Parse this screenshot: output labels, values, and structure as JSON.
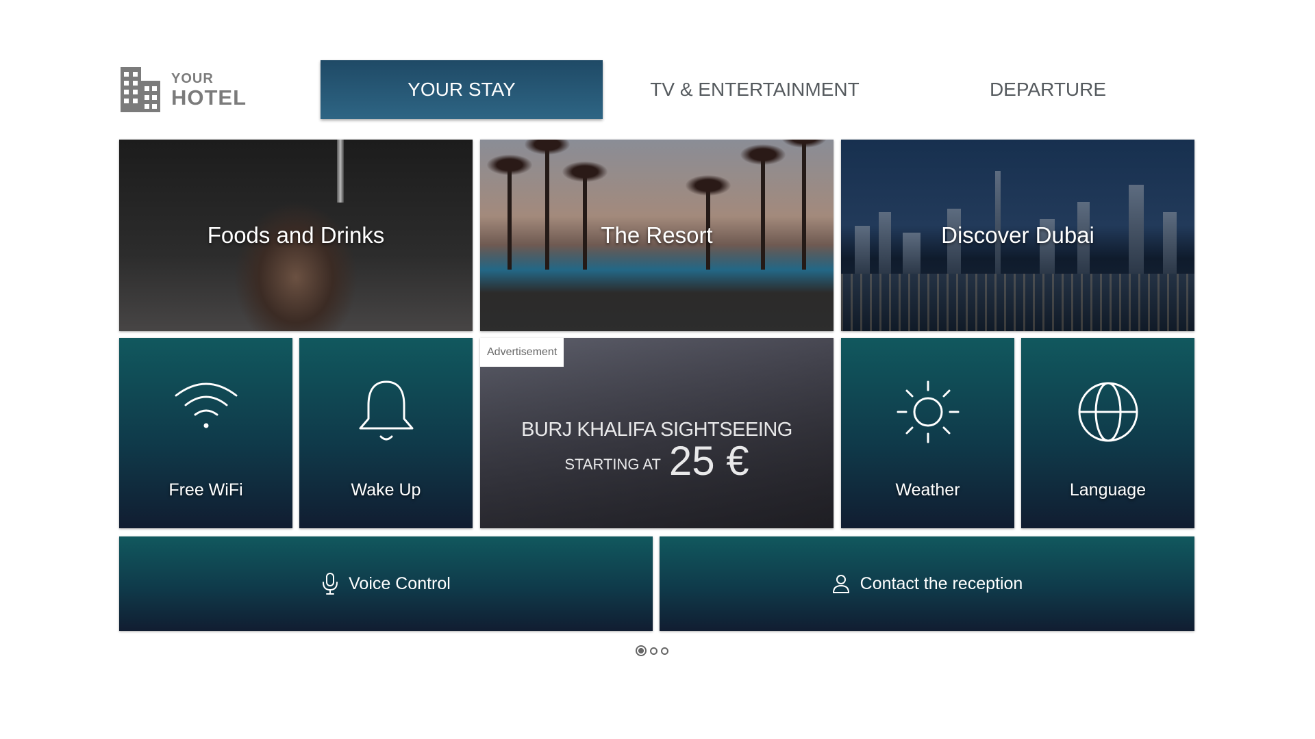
{
  "brand": {
    "small": "YOUR",
    "big": "HOTEL",
    "icon": "building-icon"
  },
  "nav": {
    "tabs": [
      {
        "label": "YOUR STAY",
        "active": true
      },
      {
        "label": "TV & ENTERTAINMENT",
        "active": false
      },
      {
        "label": "DEPARTURE",
        "active": false
      }
    ]
  },
  "tiles": {
    "foods": {
      "label": "Foods and Drinks"
    },
    "resort": {
      "label": "The Resort"
    },
    "dubai": {
      "label": "Discover Dubai"
    },
    "wifi": {
      "label": "Free WiFi",
      "icon": "wifi-icon"
    },
    "wakeup": {
      "label": "Wake Up",
      "icon": "bell-icon"
    },
    "weather": {
      "label": "Weather",
      "icon": "sun-icon"
    },
    "language": {
      "label": "Language",
      "icon": "globe-icon"
    },
    "voice": {
      "label": "Voice Control",
      "icon": "microphone-icon"
    },
    "contact": {
      "label": "Contact the reception",
      "icon": "user-icon"
    }
  },
  "ad": {
    "badge": "Advertisement",
    "title": "BURJ KHALIFA SIGHTSEEING",
    "price_prefix": "STARTING AT",
    "price": "25 €"
  },
  "pagination": {
    "pages": 3,
    "current": 1
  },
  "colors": {
    "active_tab": "#2e6584",
    "tile_teal": "#11585e",
    "tile_dark": "#111d31"
  }
}
